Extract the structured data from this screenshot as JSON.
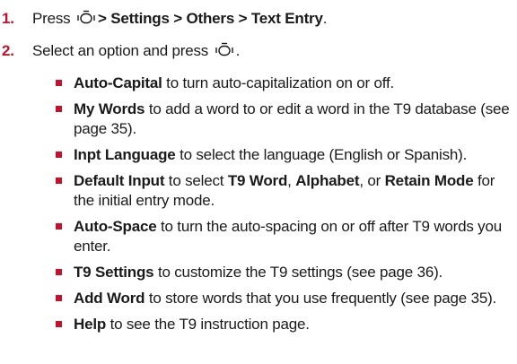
{
  "steps": [
    {
      "number": "1.",
      "prefix": "Press",
      "path": "> Settings > Others > Text Entry",
      "suffix": "."
    },
    {
      "number": "2.",
      "prefix": "Select an option and press",
      "suffix": "."
    }
  ],
  "options": [
    {
      "term": "Auto-Capital",
      "desc": " to turn auto-capitalization on or off."
    },
    {
      "term": "My Words",
      "desc": " to add a word to or edit a word in the T9 database (see page 35)."
    },
    {
      "term": "Inpt Language",
      "desc": " to select the language (English or Spanish)."
    },
    {
      "term": "Default Input",
      "desc_a": " to select ",
      "opt1": "T9 Word",
      "sep1": ", ",
      "opt2": "Alphabet",
      "sep2": ", or ",
      "opt3": "Retain Mode",
      "desc_b": " for the initial entry mode."
    },
    {
      "term": "Auto-Space",
      "desc": " to turn the auto-spacing on or off after T9 words you enter."
    },
    {
      "term": "T9 Settings",
      "desc": " to customize the T9 settings (see page 36)."
    },
    {
      "term": "Add Word",
      "desc": " to store words that you use frequently (see page 35)."
    },
    {
      "term": "Help",
      "desc": " to see the T9 instruction page."
    }
  ],
  "colors": {
    "accent": "#c8102e",
    "text": "#1a1a1a"
  },
  "icons": {
    "menu_key": "menu-ok-key-icon"
  }
}
